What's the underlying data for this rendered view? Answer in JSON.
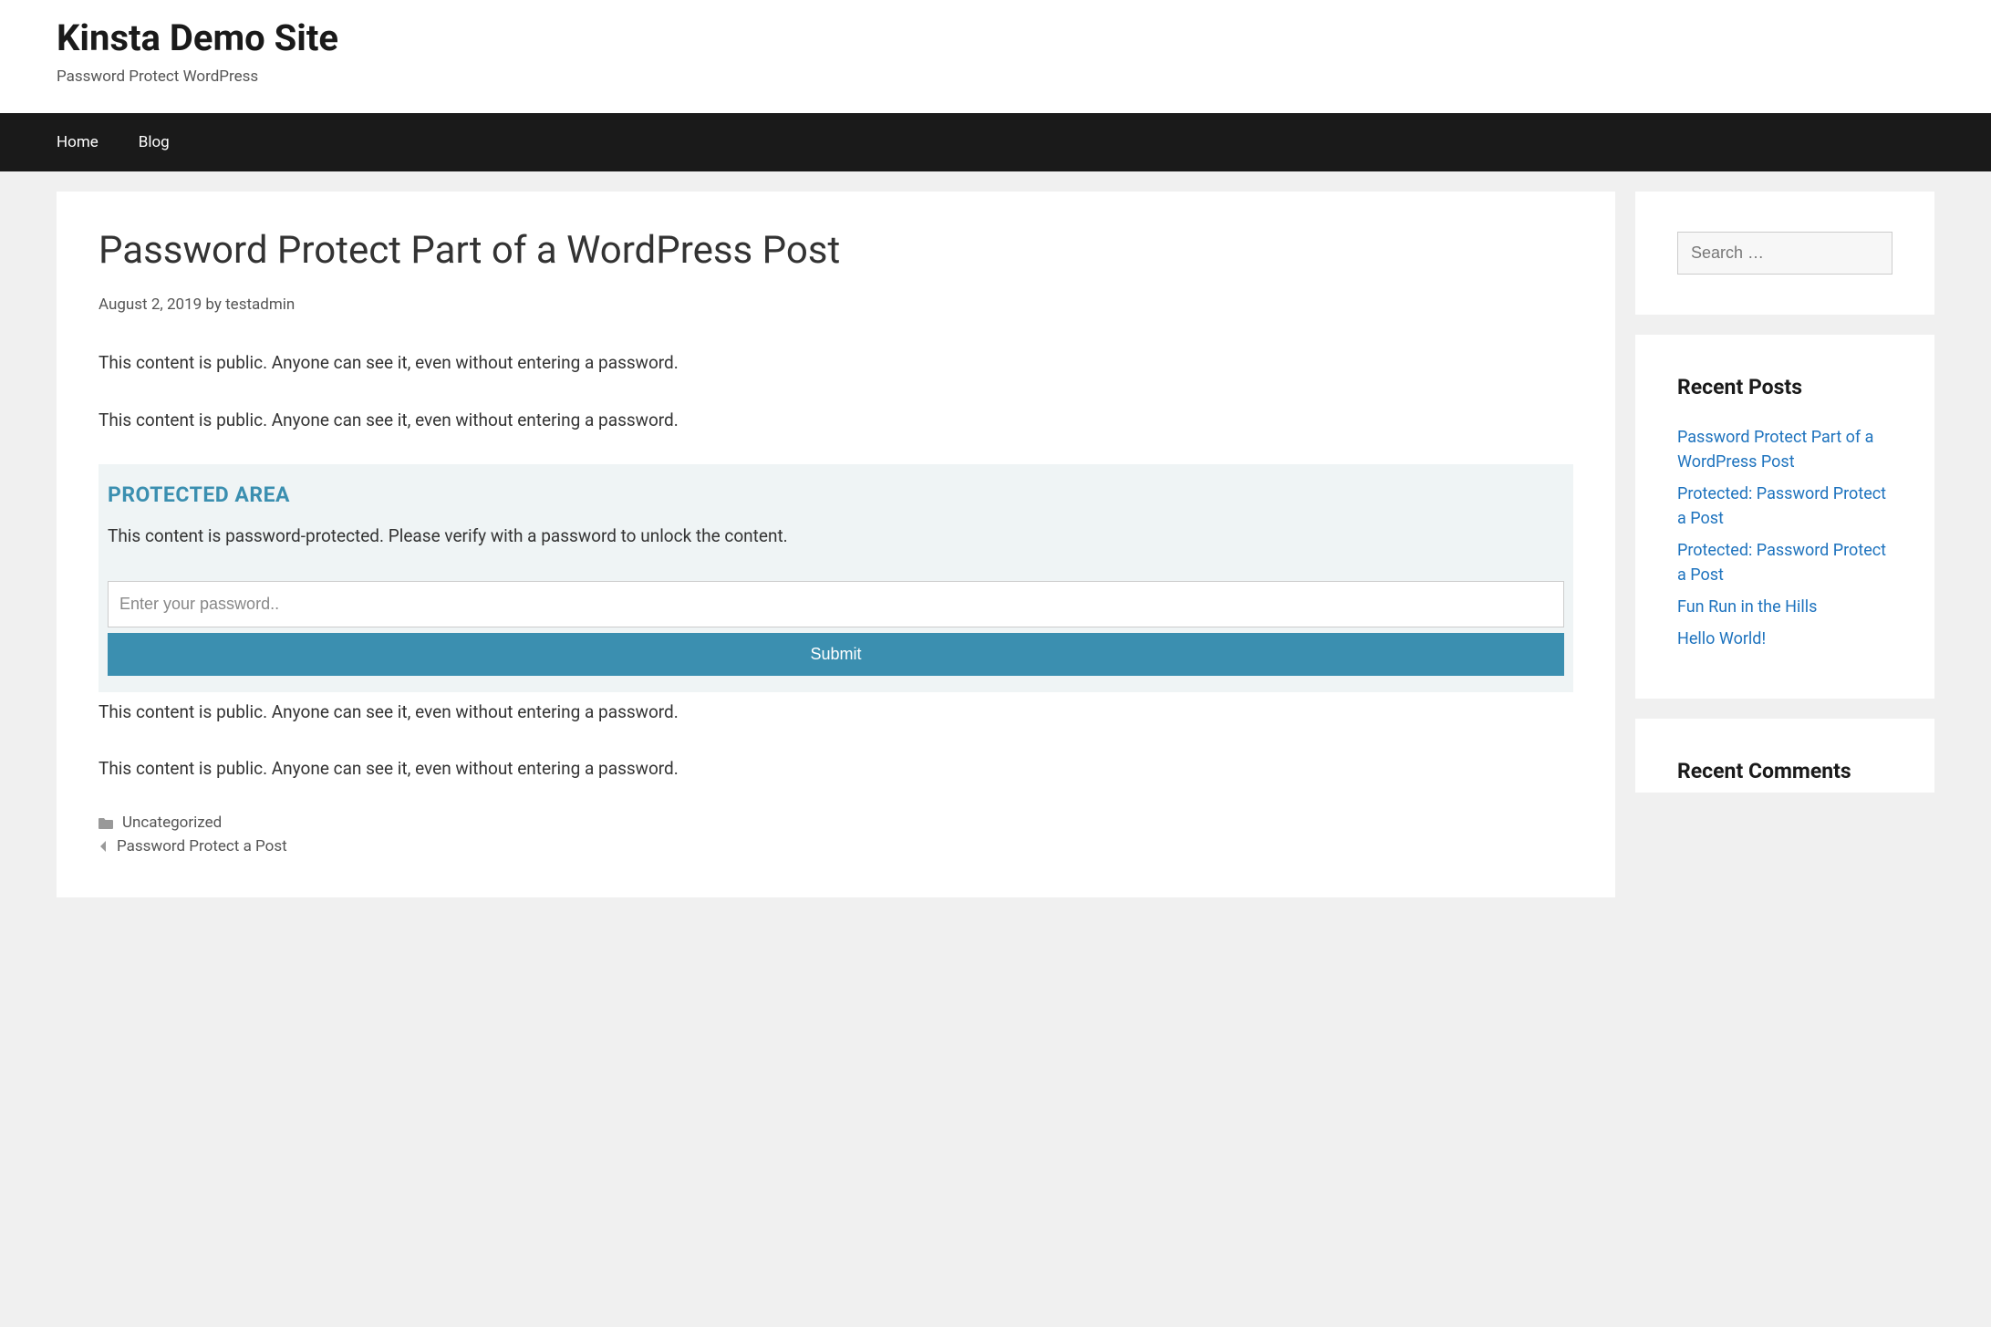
{
  "header": {
    "site_title": "Kinsta Demo Site",
    "tagline": "Password Protect WordPress"
  },
  "nav": {
    "items": [
      {
        "label": "Home"
      },
      {
        "label": "Blog"
      }
    ]
  },
  "post": {
    "title": "Password Protect Part of a WordPress Post",
    "date": "August 2, 2019",
    "by_label": "by",
    "author": "testadmin",
    "paragraph_public": "This content is public. Anyone can see it, even without entering a password.",
    "protected": {
      "heading": "PROTECTED AREA",
      "message": "This content is password-protected. Please verify with a password to unlock the content.",
      "placeholder": "Enter your password..",
      "submit_label": "Submit"
    },
    "footer": {
      "category": "Uncategorized",
      "prev_post": "Password Protect a Post"
    }
  },
  "sidebar": {
    "search_placeholder": "Search …",
    "recent_posts_title": "Recent Posts",
    "recent_posts": [
      "Password Protect Part of a WordPress Post",
      "Protected: Password Protect a Post",
      "Protected: Password Protect a Post",
      "Fun Run in the Hills",
      "Hello World!"
    ],
    "recent_comments_title": "Recent Comments"
  }
}
